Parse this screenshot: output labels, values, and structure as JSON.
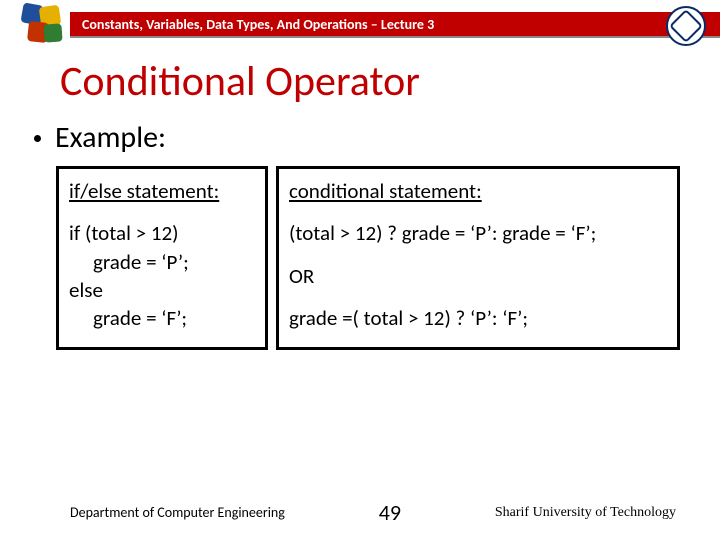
{
  "header": {
    "lecture_line": "Constants, Variables, Data Types, And Operations – Lecture 3"
  },
  "title": "Conditional Operator",
  "bullet": "Example:",
  "left_box": {
    "heading": "if/else statement:",
    "line1": "if (total > 12)",
    "line2": "grade = ‘P’;",
    "line3": "else",
    "line4": "grade = ‘F’;"
  },
  "right_box": {
    "heading": "conditional statement:",
    "line1": "(total > 12) ? grade = ‘P’: grade = ‘F’;",
    "or": "OR",
    "line2": "grade =( total > 12) ? ‘P’: ‘F’;"
  },
  "footer": {
    "department": "Department of Computer Engineering",
    "page": "49",
    "university": "Sharif University of Technology"
  }
}
